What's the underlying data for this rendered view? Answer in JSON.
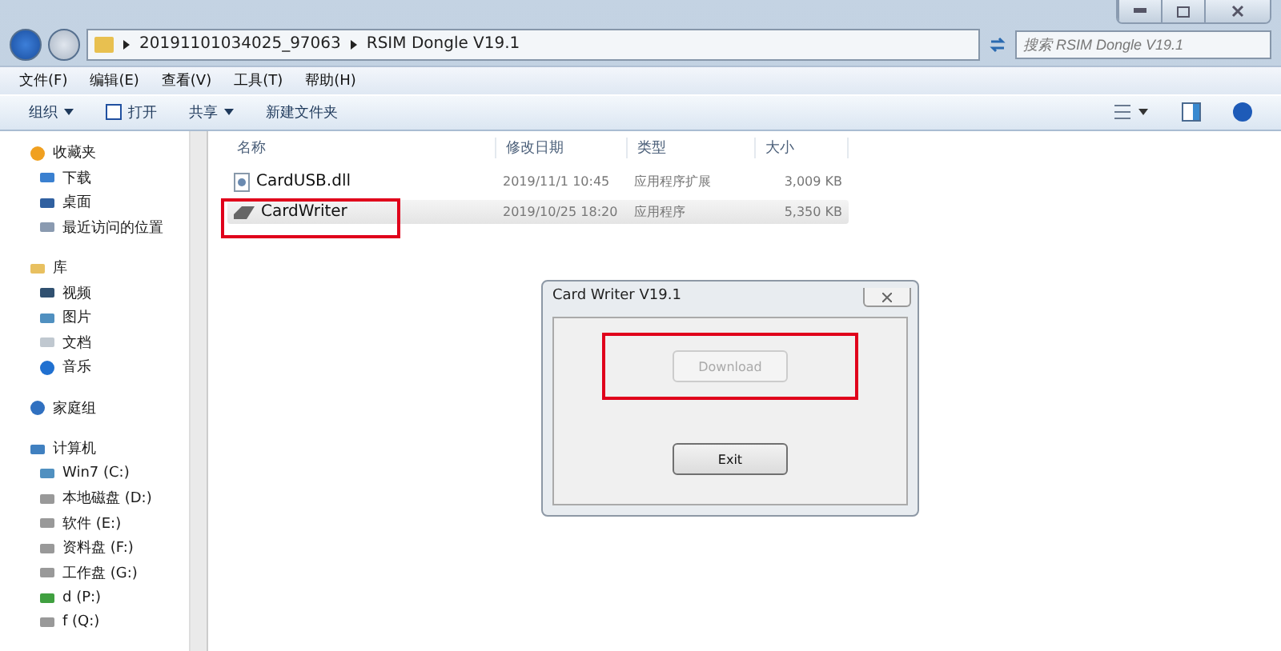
{
  "address": {
    "crumbs": [
      "20191101034025_97063",
      "RSIM Dongle V19.1"
    ]
  },
  "search": {
    "placeholder": "搜索 RSIM Dongle V19.1"
  },
  "menu": [
    "文件(F)",
    "编辑(E)",
    "查看(V)",
    "工具(T)",
    "帮助(H)"
  ],
  "toolbar": [
    {
      "label": "组织",
      "kind": "dropdown"
    },
    {
      "label": "打开",
      "kind": "open"
    },
    {
      "label": "共享",
      "kind": "dropdown"
    },
    {
      "label": "新建文件夹",
      "kind": "plain"
    }
  ],
  "sidebar": [
    {
      "label": "收藏夹",
      "kind": "star",
      "children": [
        {
          "label": "下载",
          "kind": "download"
        },
        {
          "label": "桌面",
          "kind": "desktop"
        },
        {
          "label": "最近访问的位置",
          "kind": "recent"
        }
      ]
    },
    {
      "label": "库",
      "kind": "library",
      "children": [
        {
          "label": "视频",
          "kind": "video"
        },
        {
          "label": "图片",
          "kind": "image"
        },
        {
          "label": "文档",
          "kind": "doc"
        },
        {
          "label": "音乐",
          "kind": "music"
        }
      ]
    },
    {
      "label": "家庭组",
      "kind": "homegroup"
    },
    {
      "label": "计算机",
      "kind": "computer",
      "children": [
        {
          "label": "Win7 (C:)",
          "kind": "sysdrive"
        },
        {
          "label": "本地磁盘 (D:)",
          "kind": "drive"
        },
        {
          "label": "软件 (E:)",
          "kind": "drive"
        },
        {
          "label": "资料盘 (F:)",
          "kind": "drive"
        },
        {
          "label": "工作盘 (G:)",
          "kind": "drive"
        },
        {
          "label": "d (P:)",
          "kind": "netdrive"
        },
        {
          "label": "f (Q:)",
          "kind": "drive"
        }
      ]
    }
  ],
  "columns": [
    "名称",
    "修改日期",
    "类型",
    "大小"
  ],
  "files": [
    {
      "name": "CardUSB.dll",
      "kind": "dll",
      "date": "2019/11/1 10:45",
      "type": "应用程序扩展",
      "size": "3,009 KB",
      "selected": false,
      "highlighted": false
    },
    {
      "name": "CardWriter",
      "kind": "exe",
      "date": "2019/10/25 18:20",
      "type": "应用程序",
      "size": "5,350 KB",
      "selected": true,
      "highlighted": true
    }
  ],
  "dialog": {
    "title": "Card Writer V19.1",
    "buttons": [
      {
        "label": "Download",
        "disabled": true,
        "highlighted": true
      },
      {
        "label": "Exit",
        "disabled": false,
        "highlighted": false
      }
    ]
  }
}
